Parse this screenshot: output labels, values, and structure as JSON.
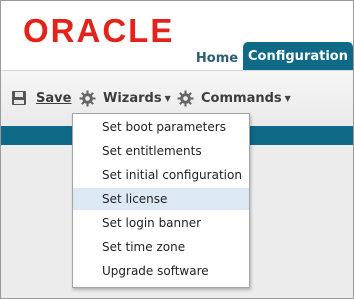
{
  "header": {
    "logo_text": "ORACLE",
    "tabs": [
      {
        "label": "Home",
        "active": false
      },
      {
        "label": "Configuration",
        "active": true
      }
    ]
  },
  "toolbar": {
    "save_label": "Save",
    "wizards_label": "Wizards",
    "commands_label": "Commands",
    "save_icon": "floppy-disk-icon",
    "wizards_icon": "gear-icon",
    "commands_icon": "gear-icon"
  },
  "wizards_menu": {
    "items": [
      {
        "label": "Set boot parameters"
      },
      {
        "label": "Set entitlements"
      },
      {
        "label": "Set initial configuration"
      },
      {
        "label": "Set license",
        "highlighted": true
      },
      {
        "label": "Set login banner"
      },
      {
        "label": "Set time zone"
      },
      {
        "label": "Upgrade software"
      }
    ]
  },
  "colors": {
    "brand_red": "#e2231a",
    "accent_teal": "#0e6a86",
    "menu_highlight": "#dde8f5"
  }
}
